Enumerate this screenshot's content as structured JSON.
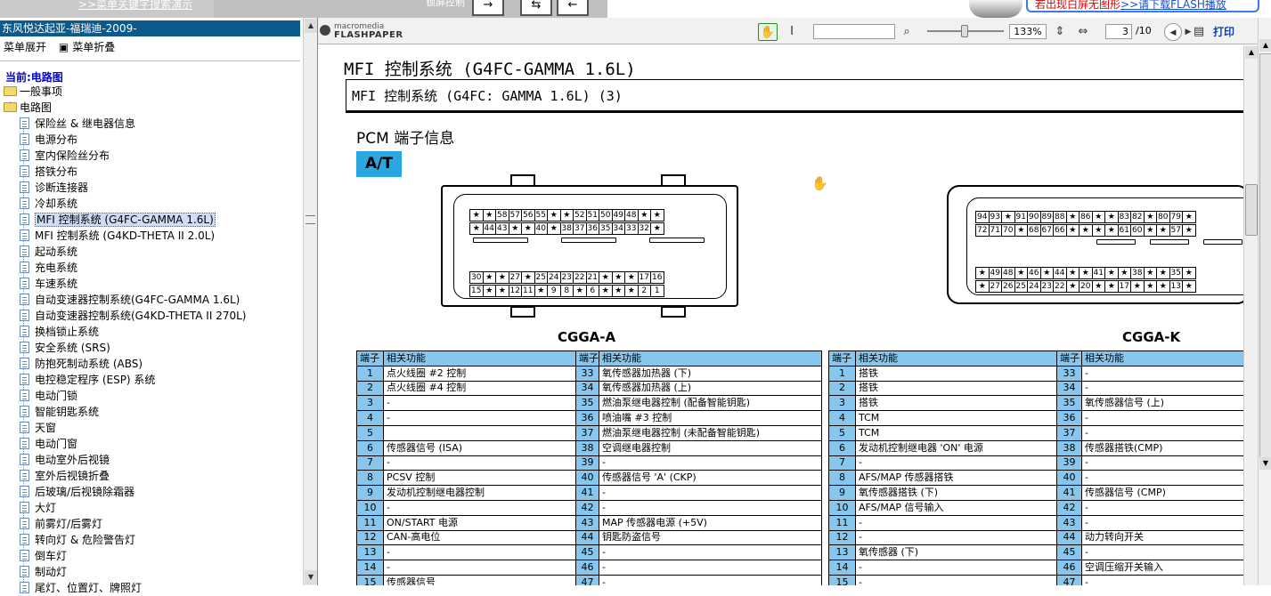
{
  "topbar": {
    "search_demo_link": ">>菜单关键字搜索演示",
    "toolbar_label": "锁屏控制",
    "nav_buttons": [
      "→",
      "⇆",
      "←"
    ],
    "download_red": "若出现白屏无图形",
    "download_link": ">>请下载FLASH播放"
  },
  "sidebar": {
    "title": "东风悦达起亚-福瑞迪-2009-",
    "expand_label": "菜单展开",
    "collapse_label": "菜单折叠",
    "current_label": "当前:电路图",
    "folders": [
      "一般事项",
      "电路图"
    ],
    "items": [
      "保险丝 & 继电器信息",
      "电源分布",
      "室内保险丝分布",
      "搭铁分布",
      "诊断连接器",
      "冷却系统",
      "MFI 控制系统 (G4FC-GAMMA 1.6L)",
      "MFI 控制系统 (G4KD-THETA II 2.0L)",
      "起动系统",
      "充电系统",
      "车速系统",
      "自动变速器控制系统(G4FC-GAMMA 1.6L)",
      "自动变速器控制系统(G4KD-THETA II 270L)",
      "换档锁止系统",
      "安全系统 (SRS)",
      "防抱死制动系统 (ABS)",
      "电控稳定程序 (ESP) 系统",
      "电动门锁",
      "智能钥匙系统",
      "天窗",
      "电动门窗",
      "电动室外后视镜",
      "室外后视镜折叠",
      "后玻璃/后视镜除霜器",
      "大灯",
      "前雾灯/后雾灯",
      "转向灯 & 危险警告灯",
      "倒车灯",
      "制动灯",
      "尾灯、位置灯、牌照灯"
    ],
    "selected_index": 6
  },
  "viewer": {
    "brand_small": "macromedia",
    "brand": "FLASHPAPER",
    "zoom": "133%",
    "page": "3",
    "pages": "/10",
    "print_label": "打印",
    "icons": {
      "hand": "✋",
      "cursor": "I",
      "glass": "⌕",
      "fit_width": "⇕",
      "fit_page": "⇔",
      "prev": "◀",
      "next": "▶",
      "printer": "▤"
    }
  },
  "document": {
    "title": "MFI 控制系统 (G4FC-GAMMA 1.6L)",
    "subtitle": "MFI 控制系统 (G4FC: GAMMA 1.6L) (3)",
    "section": "PCM 端子信息",
    "badge": "A/T",
    "connector_a": {
      "name": "CGGA-A",
      "row1": [
        "★",
        "★",
        "58",
        "57",
        "56",
        "55",
        "★",
        "★",
        "52",
        "51",
        "50",
        "49",
        "48",
        "★",
        "★"
      ],
      "row2": [
        "★",
        "44",
        "43",
        "★",
        "★",
        "40",
        "★",
        "38",
        "37",
        "36",
        "35",
        "34",
        "33",
        "32",
        "★"
      ],
      "row3": [
        "30",
        "★",
        "★",
        "27",
        "★",
        "25",
        "24",
        "23",
        "22",
        "21",
        "★",
        "★",
        "★",
        "17",
        "16"
      ],
      "row4": [
        "15",
        "★",
        "★",
        "12",
        "11",
        "★",
        "9",
        "8",
        "★",
        "6",
        "★",
        "★",
        "★",
        "2",
        "1"
      ]
    },
    "connector_k": {
      "name": "CGGA-K",
      "row1": [
        "94",
        "93",
        "★",
        "91",
        "90",
        "89",
        "88",
        "★",
        "86",
        "★",
        "★",
        "83",
        "82",
        "★",
        "80",
        "79",
        "★"
      ],
      "row2": [
        "72",
        "71",
        "70",
        "★",
        "68",
        "67",
        "66",
        "★",
        "★",
        "★",
        "★",
        "61",
        "60",
        "★",
        "★",
        "57",
        "★"
      ],
      "row3": [
        "★",
        "49",
        "48",
        "★",
        "46",
        "★",
        "44",
        "★",
        "★",
        "41",
        "★",
        "★",
        "38",
        "★",
        "★",
        "35",
        "★"
      ],
      "row4": [
        "★",
        "27",
        "26",
        "25",
        "24",
        "23",
        "22",
        "★",
        "20",
        "★",
        "★",
        "17",
        "★",
        "★",
        "★",
        "13",
        "★"
      ]
    },
    "table_headers": [
      "端子",
      "相关功能",
      "端子",
      "相关功能"
    ],
    "table_a": [
      [
        "1",
        "点火线圈 #2 控制",
        "33",
        "氧传感器加热器 (下)"
      ],
      [
        "2",
        "点火线圈 #4 控制",
        "34",
        "氧传感器加热器 (上)"
      ],
      [
        "3",
        "-",
        "35",
        "燃油泵继电器控制 (配备智能钥匙)"
      ],
      [
        "4",
        "-",
        "36",
        "喷油嘴 #3 控制"
      ],
      [
        "5",
        "",
        "37",
        "燃油泵继电器控制 (未配备智能钥匙)"
      ],
      [
        "6",
        "传感器信号 (ISA)",
        "38",
        "空调继电器控制"
      ],
      [
        "7",
        "-",
        "39",
        "-"
      ],
      [
        "8",
        "PCSV 控制",
        "40",
        "传感器信号 'A' (CKP)"
      ],
      [
        "9",
        "发动机控制继电器控制",
        "41",
        "-"
      ],
      [
        "10",
        "-",
        "42",
        "-"
      ],
      [
        "11",
        "ON/START 电源",
        "43",
        "MAP 传感器电源 (+5V)"
      ],
      [
        "12",
        "CAN-高电位",
        "44",
        "钥匙防盗信号"
      ],
      [
        "13",
        "-",
        "45",
        "-"
      ],
      [
        "14",
        "-",
        "46",
        "-"
      ],
      [
        "15",
        "传感器信号",
        "47",
        "-"
      ]
    ],
    "table_k": [
      [
        "1",
        "搭铁",
        "33",
        "-"
      ],
      [
        "2",
        "搭铁",
        "34",
        "-"
      ],
      [
        "3",
        "搭铁",
        "35",
        "氧传感器信号 (上)"
      ],
      [
        "4",
        "TCM",
        "36",
        "-"
      ],
      [
        "5",
        "TCM",
        "37",
        "-"
      ],
      [
        "6",
        "发动机控制继电器 'ON' 电源",
        "38",
        "传感器搭铁(CMP)"
      ],
      [
        "7",
        "-",
        "39",
        "-"
      ],
      [
        "8",
        "AFS/MAP 传感器搭铁",
        "40",
        "-"
      ],
      [
        "9",
        "氧传感器搭铁 (下)",
        "41",
        "传感器信号 (CMP)"
      ],
      [
        "10",
        "AFS/MAP 信号输入",
        "42",
        "-"
      ],
      [
        "11",
        "-",
        "43",
        "-"
      ],
      [
        "12",
        "-",
        "44",
        "动力转向开关"
      ],
      [
        "13",
        "氧传感器 (下)",
        "45",
        "-"
      ],
      [
        "14",
        "-",
        "46",
        "空调压缩开关输入"
      ],
      [
        "15",
        "-",
        "47",
        "-"
      ]
    ]
  }
}
